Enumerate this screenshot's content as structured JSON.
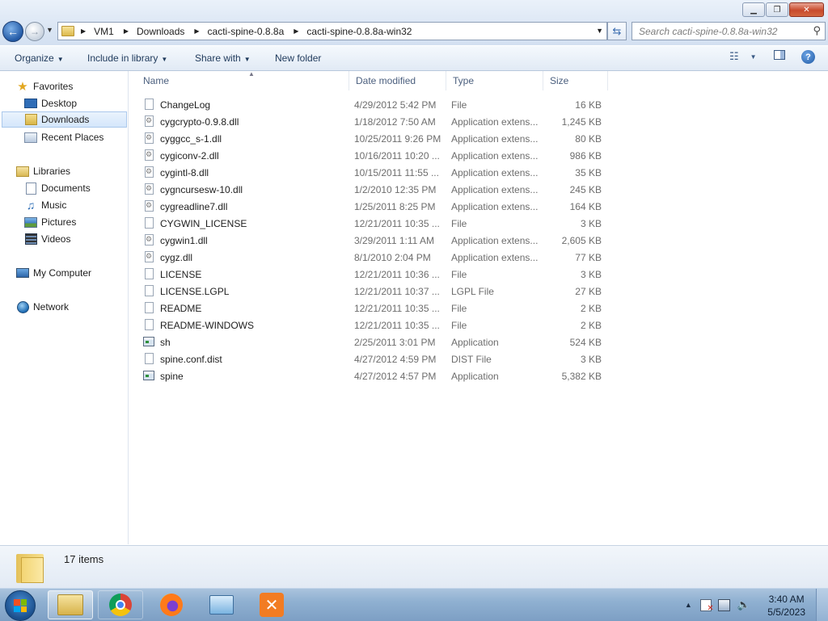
{
  "window": {
    "breadcrumb": [
      "VM1",
      "Downloads",
      "cacti-spine-0.8.8a",
      "cacti-spine-0.8.8a-win32"
    ],
    "search_placeholder": "Search cacti-spine-0.8.8a-win32",
    "minimize": "▁",
    "maximize": "❐",
    "close": "✕"
  },
  "commandbar": {
    "organize": "Organize",
    "include_in_library": "Include in library",
    "share_with": "Share with",
    "new_folder": "New folder"
  },
  "navpane": {
    "favorites": "Favorites",
    "desktop": "Desktop",
    "downloads": "Downloads",
    "recent_places": "Recent Places",
    "libraries": "Libraries",
    "documents": "Documents",
    "music": "Music",
    "pictures": "Pictures",
    "videos": "Videos",
    "my_computer": "My Computer",
    "network": "Network"
  },
  "columns": {
    "name": "Name",
    "date_modified": "Date modified",
    "type": "Type",
    "size": "Size"
  },
  "files": [
    {
      "name": "ChangeLog",
      "date": "4/29/2012 5:42 PM",
      "type": "File",
      "size": "16 KB",
      "icon": "file-icon"
    },
    {
      "name": "cygcrypto-0.9.8.dll",
      "date": "1/18/2012 7:50 AM",
      "type": "Application extens...",
      "size": "1,245 KB",
      "icon": "dll-icon"
    },
    {
      "name": "cyggcc_s-1.dll",
      "date": "10/25/2011 9:26 PM",
      "type": "Application extens...",
      "size": "80 KB",
      "icon": "dll-icon"
    },
    {
      "name": "cygiconv-2.dll",
      "date": "10/16/2011 10:20 ...",
      "type": "Application extens...",
      "size": "986 KB",
      "icon": "dll-icon"
    },
    {
      "name": "cygintl-8.dll",
      "date": "10/15/2011 11:55 ...",
      "type": "Application extens...",
      "size": "35 KB",
      "icon": "dll-icon"
    },
    {
      "name": "cygncursesw-10.dll",
      "date": "1/2/2010 12:35 PM",
      "type": "Application extens...",
      "size": "245 KB",
      "icon": "dll-icon"
    },
    {
      "name": "cygreadline7.dll",
      "date": "1/25/2011 8:25 PM",
      "type": "Application extens...",
      "size": "164 KB",
      "icon": "dll-icon"
    },
    {
      "name": "CYGWIN_LICENSE",
      "date": "12/21/2011 10:35 ...",
      "type": "File",
      "size": "3 KB",
      "icon": "file-icon"
    },
    {
      "name": "cygwin1.dll",
      "date": "3/29/2011 1:11 AM",
      "type": "Application extens...",
      "size": "2,605 KB",
      "icon": "dll-icon"
    },
    {
      "name": "cygz.dll",
      "date": "8/1/2010 2:04 PM",
      "type": "Application extens...",
      "size": "77 KB",
      "icon": "dll-icon"
    },
    {
      "name": "LICENSE",
      "date": "12/21/2011 10:36 ...",
      "type": "File",
      "size": "3 KB",
      "icon": "file-icon"
    },
    {
      "name": "LICENSE.LGPL",
      "date": "12/21/2011 10:37 ...",
      "type": "LGPL File",
      "size": "27 KB",
      "icon": "file-icon"
    },
    {
      "name": "README",
      "date": "12/21/2011 10:35 ...",
      "type": "File",
      "size": "2 KB",
      "icon": "file-icon"
    },
    {
      "name": "README-WINDOWS",
      "date": "12/21/2011 10:35 ...",
      "type": "File",
      "size": "2 KB",
      "icon": "file-icon"
    },
    {
      "name": "sh",
      "date": "2/25/2011 3:01 PM",
      "type": "Application",
      "size": "524 KB",
      "icon": "app-icon"
    },
    {
      "name": "spine.conf.dist",
      "date": "4/27/2012 4:59 PM",
      "type": "DIST File",
      "size": "3 KB",
      "icon": "file-icon"
    },
    {
      "name": "spine",
      "date": "4/27/2012 4:57 PM",
      "type": "Application",
      "size": "5,382 KB",
      "icon": "app-icon"
    }
  ],
  "details": {
    "item_count": "17 items"
  },
  "taskbar": {
    "time": "3:40 AM",
    "date": "5/5/2023",
    "apps": [
      "explorer-icon",
      "chrome-icon",
      "firefox-icon",
      "remote-desktop-icon",
      "xampp-icon"
    ]
  },
  "colors": {
    "accent": "#1e395b",
    "selection": "#d4e6fb"
  }
}
